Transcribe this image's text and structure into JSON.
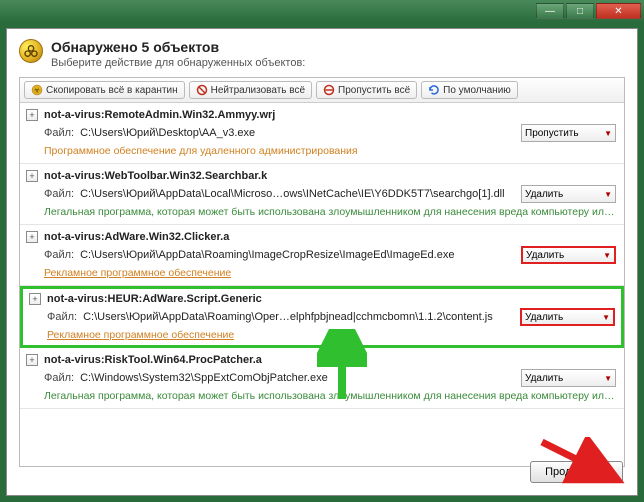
{
  "titlebar": {
    "minimize": "—",
    "maximize": "□",
    "close": "✕"
  },
  "header": {
    "title": "Обнаружено 5 объектов",
    "subtitle": "Выберите действие для обнаруженных объектов:"
  },
  "toolbar": {
    "quarantine_all": "Скопировать всё в карантин",
    "neutralize_all": "Нейтрализовать всё",
    "skip_all": "Пропустить всё",
    "default": "По умолчанию"
  },
  "labels": {
    "file_prefix": "Файл:"
  },
  "items": [
    {
      "threat": "not-a-virus:RemoteAdmin.Win32.Ammyy.wrj",
      "path": "C:\\Users\\Юрий\\Desktop\\AA_v3.exe",
      "action": "Пропустить",
      "desc": "Программное обеспечение для удаленного администрирования",
      "desc_class": "orange",
      "dd_class": "",
      "item_class": ""
    },
    {
      "threat": "not-a-virus:WebToolbar.Win32.Searchbar.k",
      "path": "C:\\Users\\Юрий\\AppData\\Local\\Microso…ows\\INetCache\\IE\\Y6DDK5T7\\searchgo[1].dll",
      "action": "Удалить",
      "desc": "Легальная программа, которая может быть использована злоумышленником для нанесения вреда компьютеру ил…",
      "desc_class": "green",
      "dd_class": "",
      "item_class": ""
    },
    {
      "threat": "not-a-virus:AdWare.Win32.Clicker.a",
      "path": "C:\\Users\\Юрий\\AppData\\Roaming\\ImageCropResize\\ImageEd\\ImageEd.exe",
      "action": "Удалить",
      "desc": "Рекламное программное обеспечение",
      "desc_class": "orange-u",
      "dd_class": "hl-red",
      "item_class": ""
    },
    {
      "threat": "not-a-virus:HEUR:AdWare.Script.Generic",
      "path": "C:\\Users\\Юрий\\AppData\\Roaming\\Oper…elphfpbjnead|cchmcbomn\\1.1.2\\content.js",
      "action": "Удалить",
      "desc": "Рекламное программное обеспечение",
      "desc_class": "orange-u",
      "dd_class": "hl-red",
      "item_class": "hl-green"
    },
    {
      "threat": "not-a-virus:RiskTool.Win64.ProcPatcher.a",
      "path": "C:\\Windows\\System32\\SppExtComObjPatcher.exe",
      "action": "Удалить",
      "desc": "Легальная программа, которая может быть использована злоумышленником для нанесения вреда компьютеру ил…",
      "desc_class": "green",
      "dd_class": "",
      "item_class": ""
    }
  ],
  "footer": {
    "continue": "Продолжить"
  }
}
